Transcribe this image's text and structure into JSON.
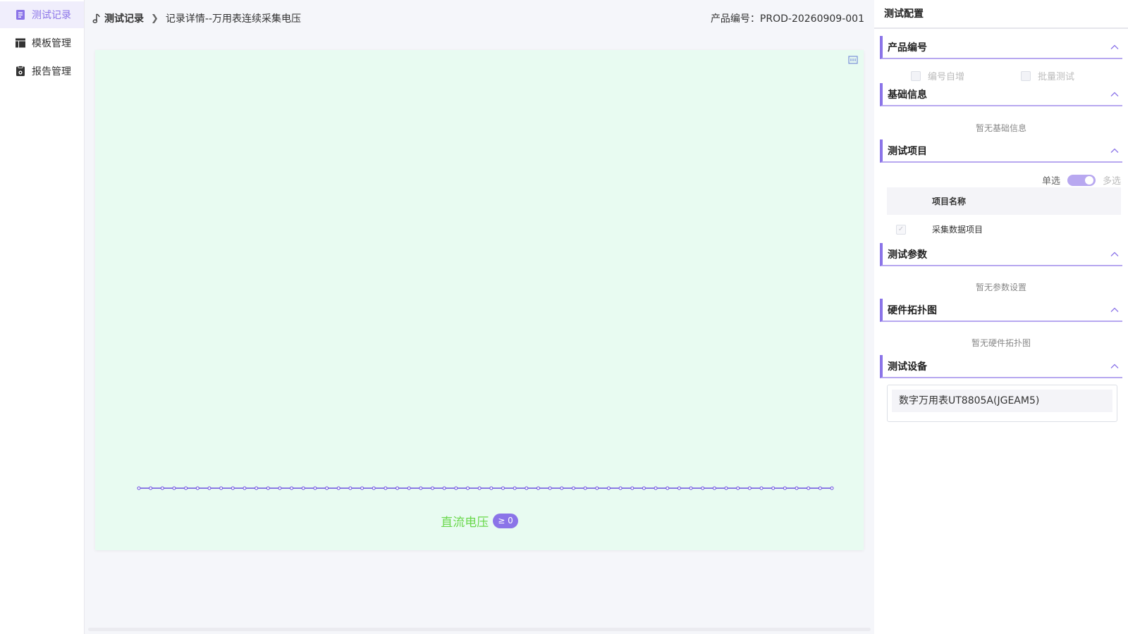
{
  "sidebar": {
    "items": [
      {
        "label": "测试记录",
        "icon": "document-icon",
        "active": true
      },
      {
        "label": "模板管理",
        "icon": "template-icon",
        "active": false
      },
      {
        "label": "报告管理",
        "icon": "report-icon",
        "active": false
      }
    ]
  },
  "breadcrumb": {
    "root": "测试记录",
    "current": "记录详情--万用表连续采集电压"
  },
  "header": {
    "product_id": "产品编号：PROD-20260909-001"
  },
  "chart": {
    "x_title": "直流电压",
    "badge": "≥ 0"
  },
  "chart_data": {
    "type": "line",
    "xlabel": "直流电压",
    "point_count": 60,
    "series": [
      {
        "color": "#6b4fe0"
      }
    ]
  },
  "panel": {
    "title": "测试配置",
    "sections": {
      "product": {
        "title": "产品编号",
        "auto_increment_label": "编号自增",
        "batch_test_label": "批量测试"
      },
      "basic": {
        "title": "基础信息",
        "empty": "暂无基础信息"
      },
      "items": {
        "title": "测试项目",
        "mode_single": "单选",
        "mode_multi": "多选",
        "column_name": "项目名称",
        "rows": [
          {
            "name": "采集数据项目",
            "checked": true
          }
        ]
      },
      "params": {
        "title": "测试参数",
        "empty": "暂无参数设置"
      },
      "topology": {
        "title": "硬件拓扑图",
        "empty": "暂无硬件拓扑图"
      },
      "devices": {
        "title": "测试设备",
        "list": [
          "数字万用表UT8805A(JGEAM5)"
        ]
      }
    }
  },
  "colors": {
    "accent": "#8b74e8",
    "chart_bg": "#e8fbf1",
    "axis_label": "#6ad84c"
  }
}
